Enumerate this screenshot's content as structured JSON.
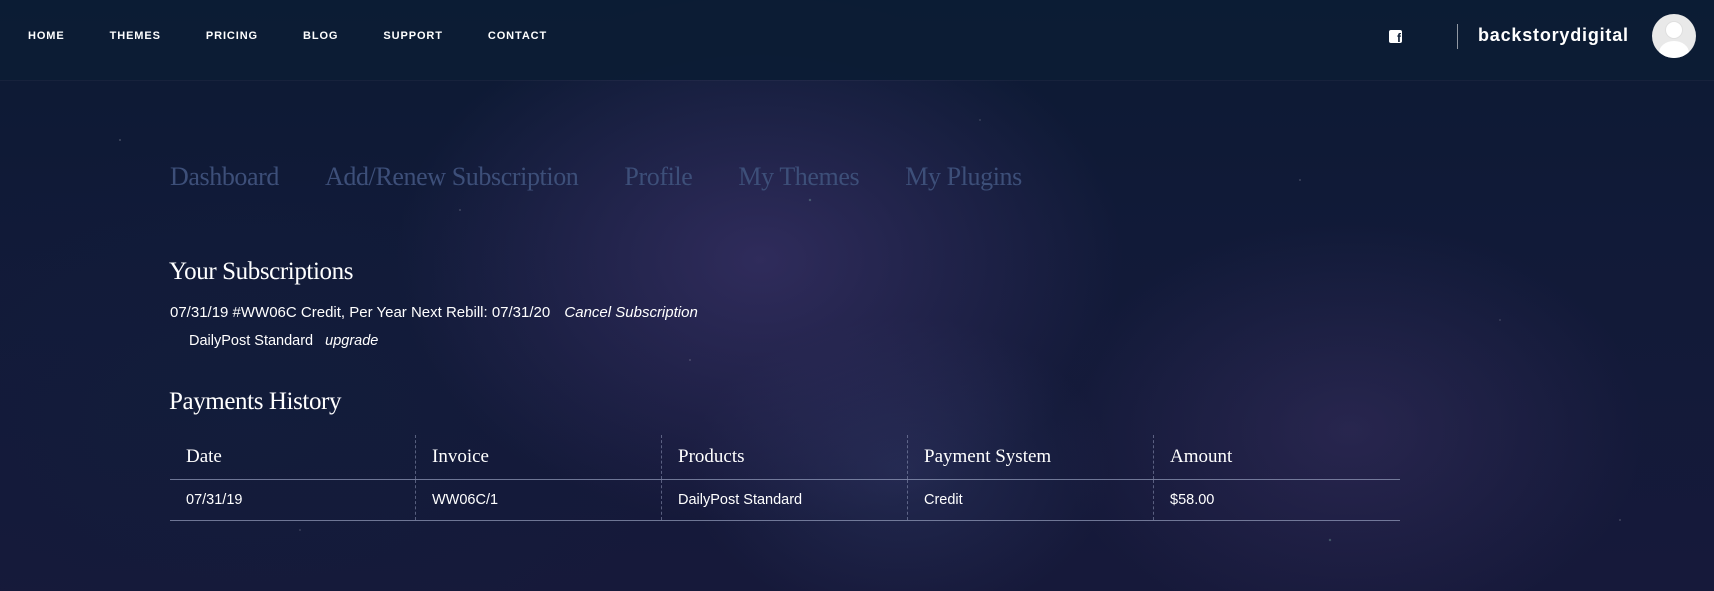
{
  "nav": {
    "items": [
      {
        "label": "HOME"
      },
      {
        "label": "THEMES"
      },
      {
        "label": "PRICING"
      },
      {
        "label": "BLOG"
      },
      {
        "label": "SUPPORT"
      },
      {
        "label": "CONTACT"
      }
    ],
    "social_icon": "facebook-icon",
    "social_glyph": "f",
    "username": "backstorydigital",
    "avatar_icon": "user-avatar-icon"
  },
  "tabs": [
    {
      "label": "Dashboard"
    },
    {
      "label": "Add/Renew Subscription"
    },
    {
      "label": "Profile"
    },
    {
      "label": "My Themes"
    },
    {
      "label": "My Plugins"
    }
  ],
  "subscriptions": {
    "title": "Your Subscriptions",
    "items": [
      {
        "summary": "07/31/19 #WW06C Credit, Per Year Next Rebill: 07/31/20",
        "cancel_label": "Cancel Subscription",
        "product": "DailyPost Standard",
        "upgrade_label": "upgrade"
      }
    ]
  },
  "payments": {
    "title": "Payments History",
    "columns": [
      "Date",
      "Invoice",
      "Products",
      "Payment System",
      "Amount"
    ],
    "rows": [
      {
        "date": "07/31/19",
        "invoice": "WW06C/1",
        "products": "DailyPost Standard",
        "payment_system": "Credit",
        "amount": "$58.00"
      }
    ]
  },
  "colors": {
    "header_bg": "#0c1c34",
    "tab_text": "#3d4f79",
    "text": "#ffffff"
  }
}
